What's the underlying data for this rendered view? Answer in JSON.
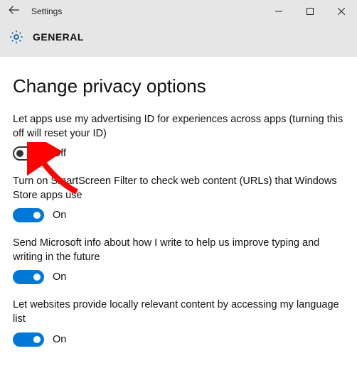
{
  "window": {
    "title": "Settings"
  },
  "header": {
    "section": "GENERAL"
  },
  "page": {
    "title": "Change privacy options"
  },
  "options": [
    {
      "desc": "Let apps use my advertising ID for experiences across apps (turning this off will reset your ID)",
      "state": "Off",
      "on": false
    },
    {
      "desc": "Turn on SmartScreen Filter to check web content (URLs) that Windows Store apps use",
      "state": "On",
      "on": true
    },
    {
      "desc": "Send Microsoft info about how I write to help us improve typing and writing in the future",
      "state": "On",
      "on": true
    },
    {
      "desc": "Let websites provide locally relevant content by accessing my language list",
      "state": "On",
      "on": true
    }
  ],
  "colors": {
    "accent": "#0078d7",
    "headerBg": "#e6e6e6",
    "arrow": "#ff0000"
  }
}
